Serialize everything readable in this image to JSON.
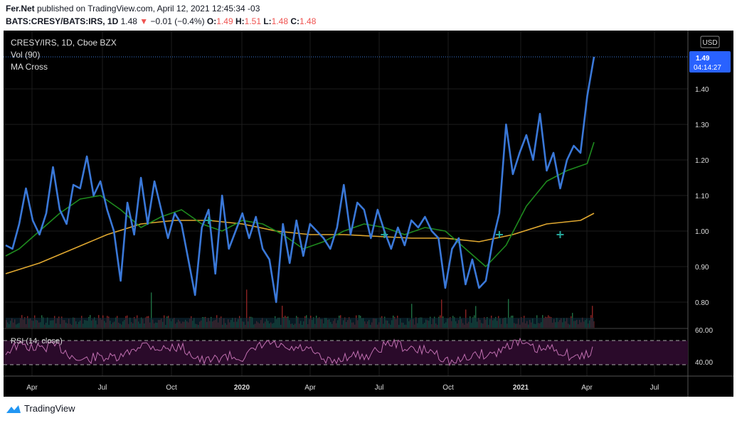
{
  "header": {
    "publisher": "Fer.Net",
    "published_text": "published on TradingView.com, April 12, 2021 12:45:34 -03",
    "symbol": "BATS:CRESY/BATS:IRS, 1D",
    "last": "1.48",
    "arrow": "▼",
    "change": "−0.01 (−0.4%)",
    "o_label": "O:",
    "o_val": "1.49",
    "h_label": "H:",
    "h_val": "1.51",
    "l_label": "L:",
    "l_val": "1.48",
    "c_label": "C:",
    "c_val": "1.48"
  },
  "legend": {
    "title": "CRESY/IRS, 1D, Cboe BZX",
    "vol": "Vol (90)",
    "ma": "MA Cross",
    "rsi": "RSI (14, close)"
  },
  "currency": "USD",
  "price_tag": {
    "value": "1.49",
    "countdown": "04:14:27"
  },
  "footer": {
    "brand": "TradingView"
  },
  "colors": {
    "background": "#000000",
    "price_line": "#3a78d8",
    "ma_short": "#1e8a1e",
    "ma_long": "#e0a830",
    "rsi_line": "#c06fb0",
    "rsi_band": "#2a0a2a",
    "vol_up": "#1f6e43",
    "vol_down": "#8b2323",
    "price_tag": "#2962ff",
    "cross_marker": "#26a69a"
  },
  "chart_data": {
    "type": "line",
    "y_ticks": [
      "1.40",
      "1.30",
      "1.20",
      "1.10",
      "1.00",
      "0.90",
      "0.80"
    ],
    "rsi_ticks": [
      "60.00",
      "40.00"
    ],
    "x_ticks": [
      "Apr",
      "Jul",
      "Oct",
      "2020",
      "Apr",
      "Jul",
      "Oct",
      "2021",
      "Apr",
      "Jul"
    ],
    "x_ticks_bold": [
      3,
      7
    ],
    "ylim": [
      0.72,
      1.5
    ],
    "xlim": [
      0,
      100
    ],
    "grid": true,
    "series": [
      {
        "name": "CRESY/IRS",
        "x": [
          0,
          1,
          2,
          3,
          4,
          5,
          6,
          7,
          8,
          9,
          10,
          11,
          12,
          13,
          14,
          15,
          16,
          17,
          18,
          19,
          20,
          21,
          22,
          23,
          24,
          25,
          26,
          27,
          28,
          29,
          30,
          31,
          32,
          33,
          34,
          35,
          36,
          37,
          38,
          39,
          40,
          41,
          42,
          43,
          44,
          45,
          46,
          47,
          48,
          49,
          50,
          51,
          52,
          53,
          54,
          55,
          56,
          57,
          58,
          59,
          60,
          61,
          62,
          63,
          64,
          65,
          66,
          67,
          68,
          69,
          70,
          71,
          72,
          73,
          74,
          75,
          76,
          77,
          78,
          79,
          80,
          81,
          82,
          83,
          84,
          85,
          86,
          87
        ],
        "y": [
          0.96,
          0.95,
          1.02,
          1.12,
          1.03,
          0.99,
          1.05,
          1.18,
          1.06,
          1.02,
          1.13,
          1.12,
          1.21,
          1.1,
          1.14,
          1.06,
          1.0,
          0.86,
          1.08,
          0.99,
          1.15,
          1.02,
          1.14,
          1.06,
          0.98,
          1.05,
          1.02,
          0.92,
          0.82,
          1.01,
          1.06,
          0.88,
          1.1,
          0.95,
          1.0,
          1.05,
          0.98,
          1.04,
          0.95,
          0.92,
          0.8,
          1.02,
          0.91,
          1.03,
          0.93,
          1.02,
          1.0,
          0.98,
          0.95,
          1.01,
          1.13,
          0.99,
          1.08,
          1.06,
          0.98,
          1.06,
          1.0,
          0.95,
          1.01,
          0.96,
          1.03,
          1.01,
          1.04,
          1.0,
          0.98,
          0.84,
          0.95,
          0.98,
          0.85,
          0.92,
          0.84,
          0.86,
          0.97,
          1.05,
          1.3,
          1.16,
          1.22,
          1.27,
          1.2,
          1.33,
          1.17,
          1.22,
          1.12,
          1.2,
          1.24,
          1.22,
          1.38,
          1.49
        ]
      },
      {
        "name": "MA short",
        "x": [
          0,
          2,
          5,
          8,
          11,
          14,
          17,
          20,
          23,
          26,
          29,
          32,
          35,
          38,
          41,
          44,
          47,
          50,
          53,
          56,
          59,
          62,
          65,
          68,
          71,
          74,
          77,
          80,
          83,
          86,
          87
        ],
        "y": [
          0.93,
          0.95,
          1.0,
          1.05,
          1.09,
          1.1,
          1.06,
          1.01,
          1.04,
          1.06,
          1.02,
          1.0,
          1.03,
          1.02,
          0.99,
          0.95,
          0.97,
          1.0,
          1.02,
          1.01,
          0.99,
          1.01,
          1.0,
          0.95,
          0.9,
          0.96,
          1.07,
          1.14,
          1.17,
          1.19,
          1.25
        ]
      },
      {
        "name": "MA long",
        "x": [
          0,
          5,
          10,
          15,
          20,
          25,
          30,
          35,
          40,
          45,
          50,
          55,
          60,
          65,
          70,
          75,
          80,
          85,
          87
        ],
        "y": [
          0.88,
          0.91,
          0.95,
          0.99,
          1.02,
          1.03,
          1.03,
          1.02,
          1.0,
          0.99,
          0.99,
          0.985,
          0.98,
          0.98,
          0.97,
          0.99,
          1.02,
          1.03,
          1.05
        ]
      }
    ]
  }
}
